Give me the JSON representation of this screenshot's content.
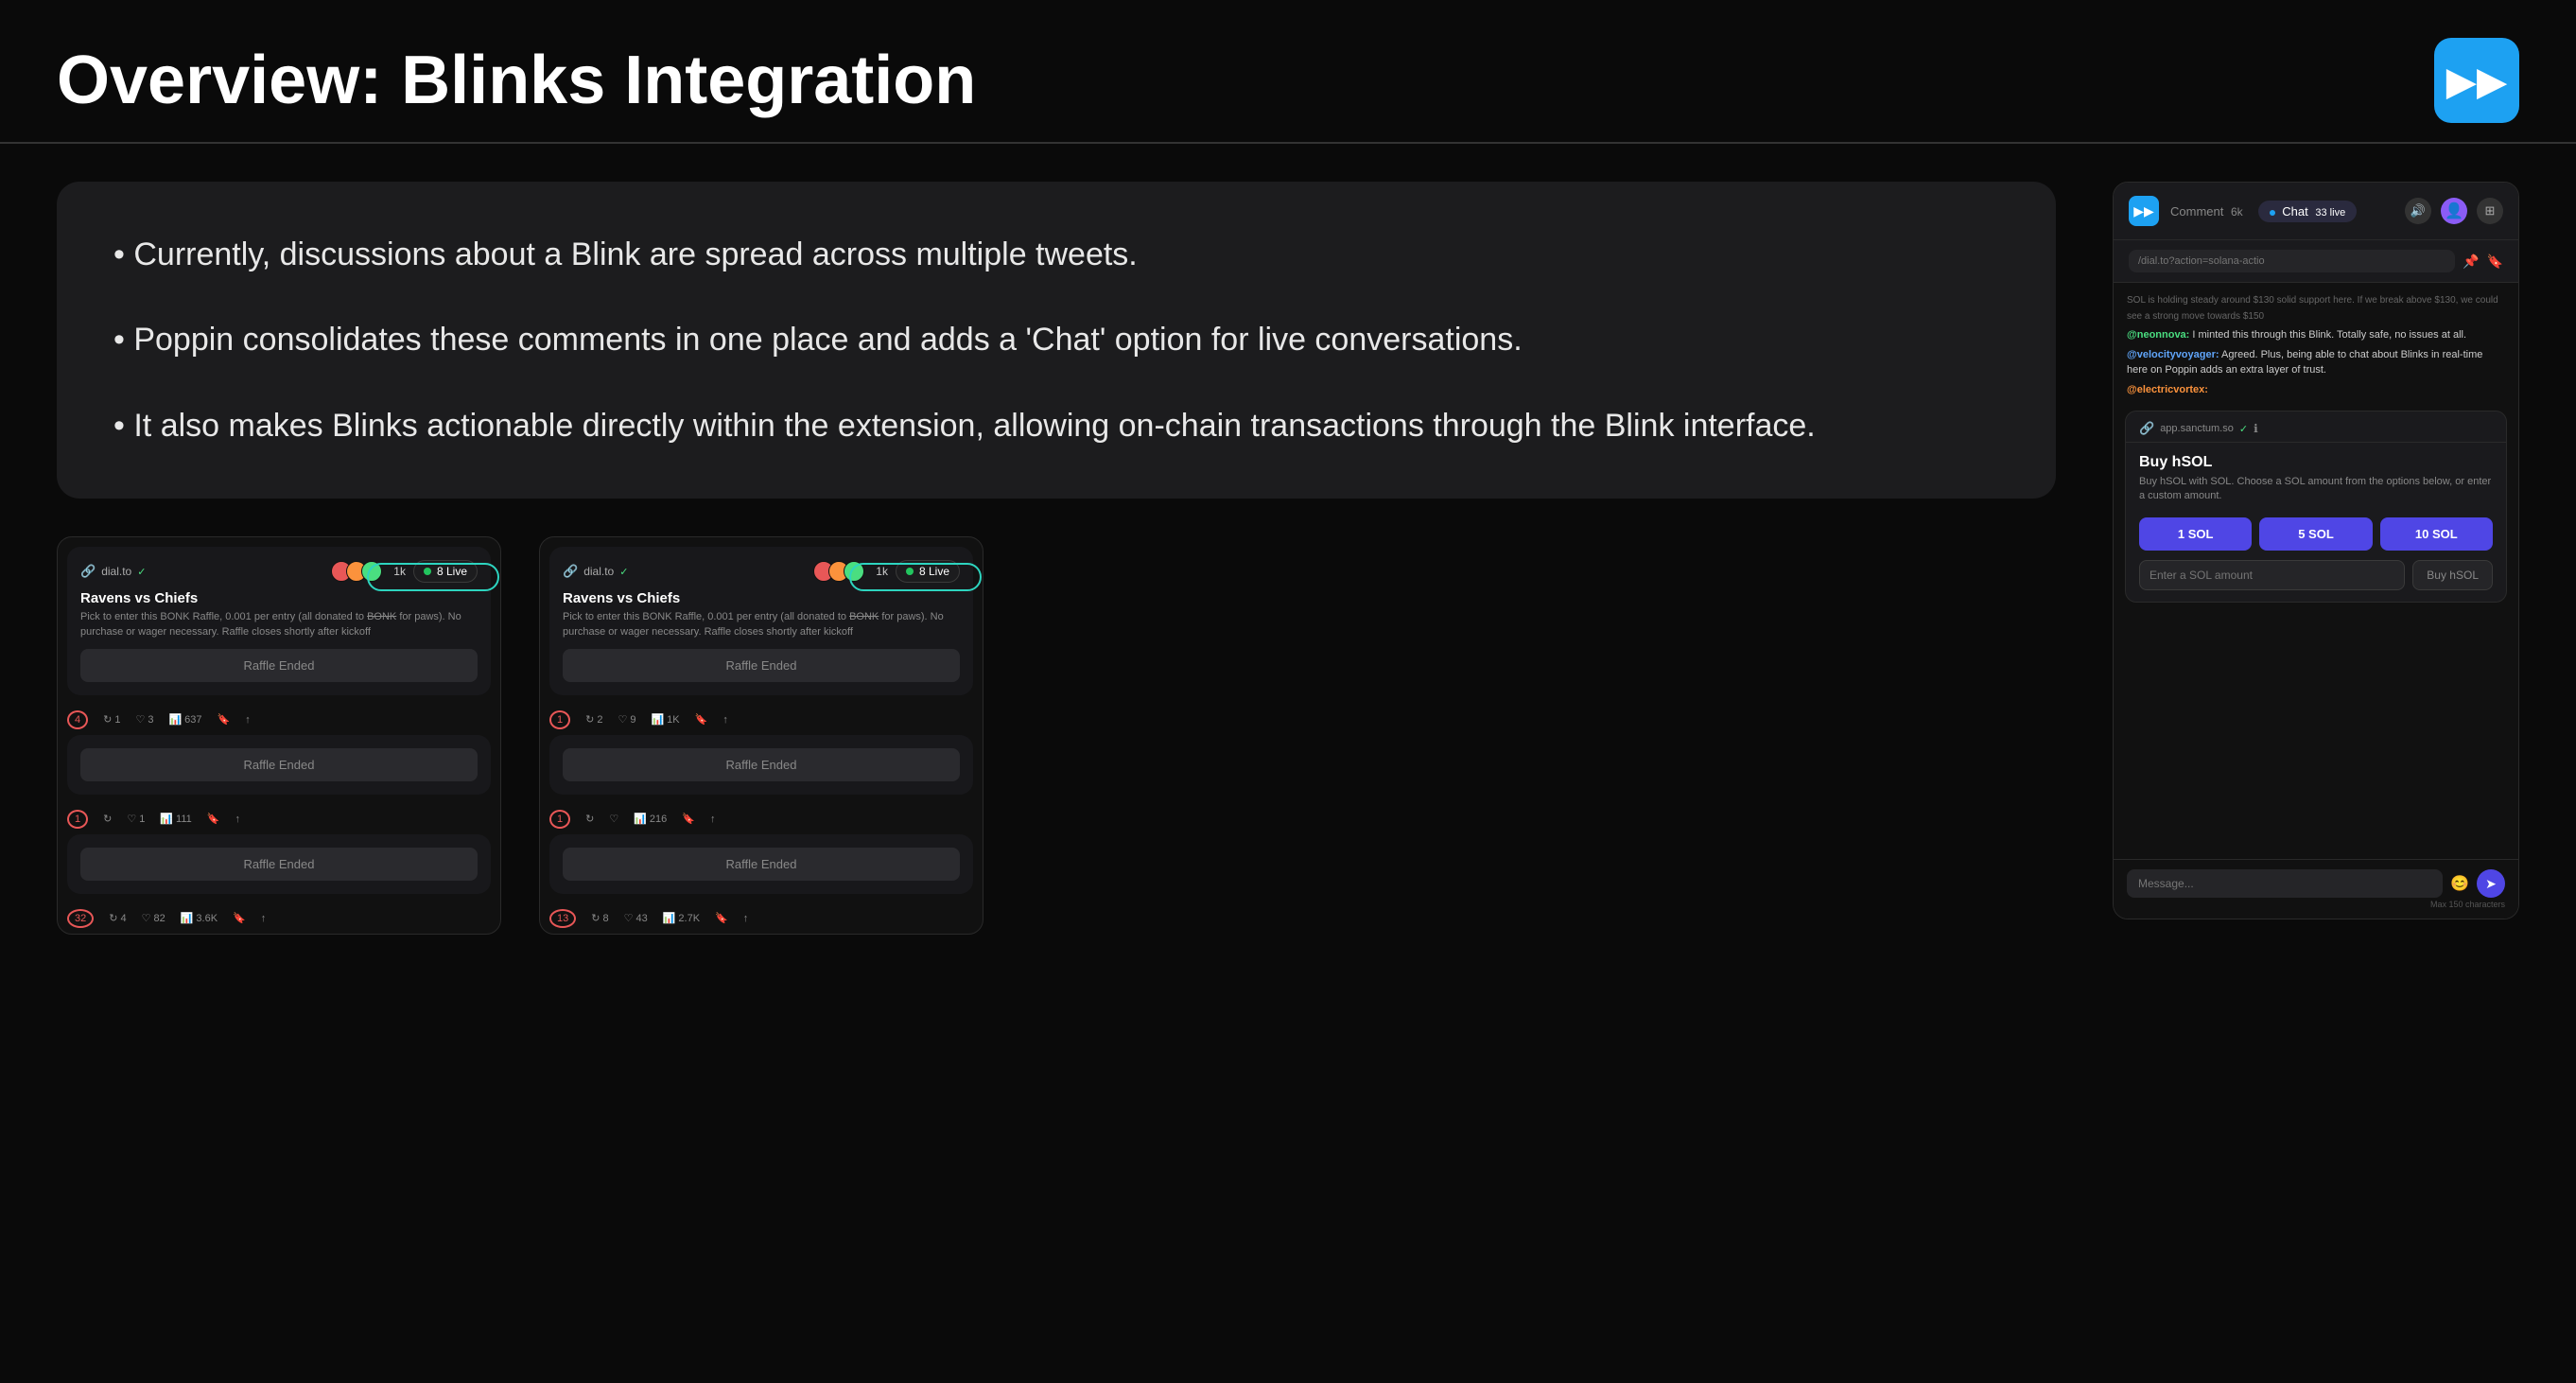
{
  "header": {
    "title": "Overview: Blinks Integration",
    "logo_icon": "▶▶"
  },
  "bullets": {
    "items": [
      "• Currently, discussions about a Blink are spread across multiple tweets.",
      "• Poppin consolidates these comments in one place and adds a 'Chat' option for live conversations.",
      "• It also makes Blinks actionable directly within the extension, allowing on-chain transactions through the Blink interface."
    ]
  },
  "tweet_card_left": {
    "source": "dial.to",
    "verified": true,
    "avatars_count": "1k",
    "live_count": "8 Live",
    "title": "Ravens vs Chiefs",
    "body": "Pick to enter this BONK Raffle, 0.001 per entry (all donated to BONK for paws). No purchase or wager necessary. Raffle closes shortly after kickoff",
    "raffle_label": "Raffle Ended",
    "actions": {
      "comments": "4",
      "retweets": "1",
      "likes": "3",
      "views": "637"
    },
    "row2_raffle": "Raffle Ended",
    "row2_comments": "1",
    "row2_retweets": "",
    "row2_likes": "1",
    "row2_views": "111",
    "row3_raffle": "Raffle Ended",
    "row3_comments": "32",
    "row3_retweets": "4",
    "row3_likes": "82",
    "row3_views": "3.6K"
  },
  "tweet_card_right": {
    "source": "dial.to",
    "verified": true,
    "avatars_count": "1k",
    "live_count": "8 Live",
    "title": "Ravens vs Chiefs",
    "body": "Pick to enter this BONK Raffle, 0.001 per entry (all donated to BONK for paws). No purchase or wager necessary. Raffle closes shortly after kickoff",
    "raffle_label": "Raffle Ended",
    "actions": {
      "comments": "1",
      "retweets": "2",
      "likes": "9",
      "views": "1K"
    },
    "row2_raffle": "Raffle Ended",
    "row2_comments": "1",
    "row2_retweets": "",
    "row2_likes": "",
    "row2_views": "216",
    "row3_raffle": "Raffle Ended",
    "row3_comments": "13",
    "row3_retweets": "8",
    "row3_likes": "43",
    "row3_views": "2.7K"
  },
  "poppin": {
    "logo": "▶▶",
    "tab_comment": "Comment",
    "tab_comment_count": "6k",
    "tab_chat": "Chat",
    "tab_chat_count": "33 live",
    "tab_chat_active": true,
    "url_placeholder": "/dial.to?action=solana-actio",
    "messages": [
      {
        "user": "",
        "text": "SOL is holding steady around $130 solid support here. If we break above $130, we could see a strong move towards $150",
        "color": "gray"
      },
      {
        "user": "@neonnova:",
        "text": " I minted this through this Blink. Totally safe, no issues at all.",
        "color": "green"
      },
      {
        "user": "@velocityvoyager:",
        "text": " Agreed. Plus, being able to chat about Blinks in real-time here on Poppin adds an extra layer of trust.",
        "color": "blue"
      },
      {
        "user": "@electricvortex:",
        "text": "",
        "color": "orange"
      }
    ],
    "blink": {
      "source": "app.sanctum.so",
      "title": "Buy hSOL",
      "description": "Buy hSOL with SOL. Choose a SOL amount from the options below, or enter a custom amount.",
      "btn1": "1 SOL",
      "btn2": "5 SOL",
      "btn3": "10 SOL",
      "input_placeholder": "Enter a SOL amount",
      "buy_label": "Buy hSOL"
    },
    "message_placeholder": "Message...",
    "max_hint": "Max 150 characters"
  }
}
